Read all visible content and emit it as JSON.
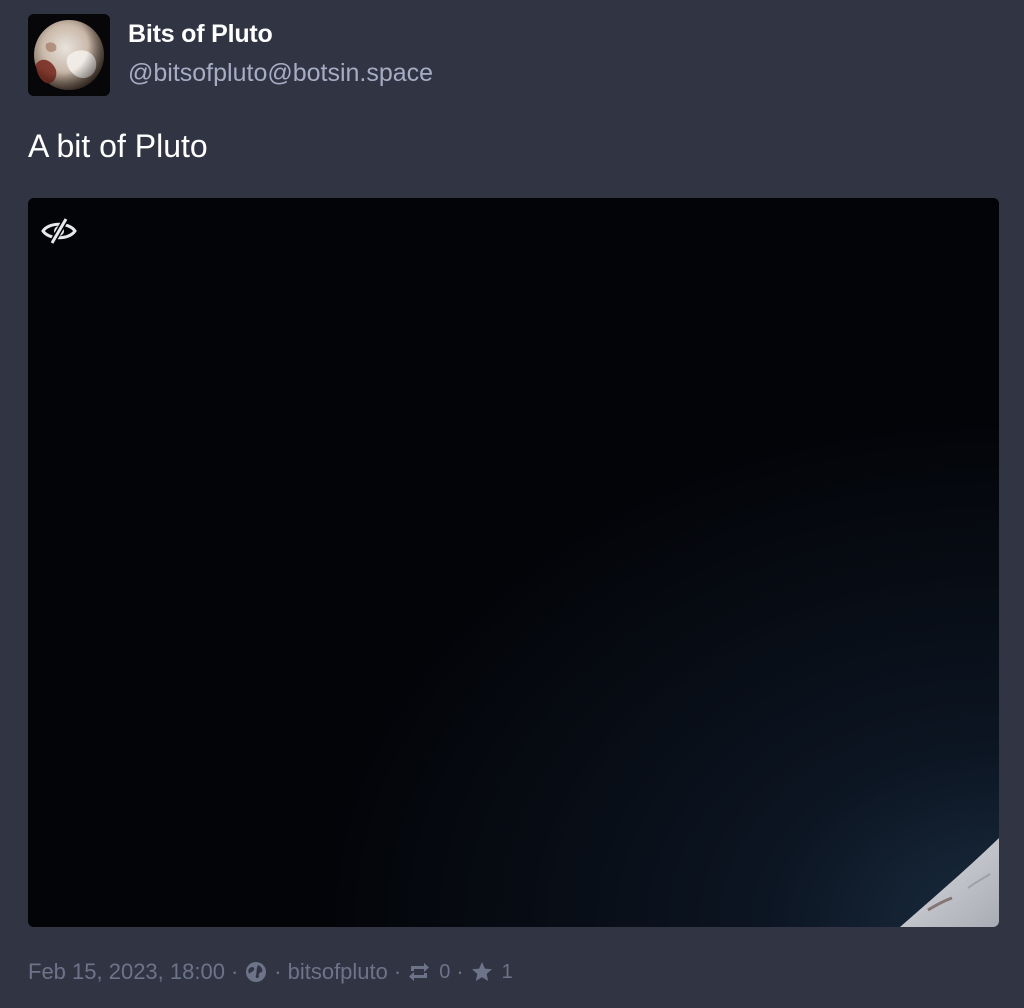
{
  "post": {
    "account": {
      "display_name": "Bits of Pluto",
      "handle": "@bitsofpluto@botsin.space",
      "avatar_icon": "pluto-avatar"
    },
    "content": "A bit of Pluto",
    "media": {
      "hide_icon": "eye-slash-icon"
    },
    "meta": {
      "timestamp": "Feb 15, 2023, 18:00",
      "visibility_icon": "globe-icon",
      "application": "bitsofpluto",
      "boost_icon": "retweet-icon",
      "boost_count": "0",
      "favourite_icon": "star-icon",
      "favourite_count": "1",
      "separator": "·"
    }
  },
  "colors": {
    "background": "#313543",
    "primary_text": "#ffffff",
    "secondary_text": "#a5acc4",
    "meta_text": "#6d7389",
    "media_background": "#040509"
  }
}
